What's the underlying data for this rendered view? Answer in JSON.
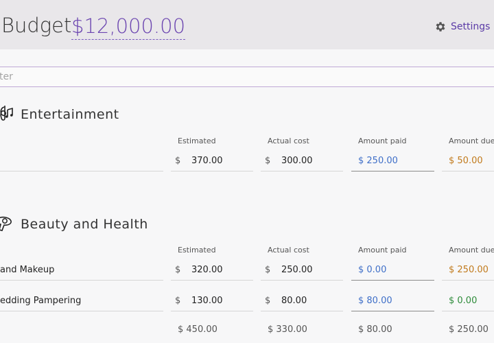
{
  "header": {
    "title": "Budget",
    "amount": "$12,000.00",
    "settings_label": "Settings"
  },
  "filter": {
    "placeholder": "ter"
  },
  "columns": {
    "estimated": "Estimated",
    "actual": "Actual cost",
    "paid": "Amount paid",
    "due": "Amount due"
  },
  "currency": "$",
  "sections": [
    {
      "title": "Entertainment",
      "icon": "music-notes-icon",
      "rows": [
        {
          "name": "",
          "estimated": "370.00",
          "actual": "300.00",
          "paid": "$ 250.00",
          "due": "$ 50.00"
        }
      ]
    },
    {
      "title": "Beauty and Health",
      "icon": "hair-dryer-icon",
      "rows": [
        {
          "name": "and Makeup",
          "estimated": "320.00",
          "actual": "250.00",
          "paid": "$ 0.00",
          "due": "$ 250.00"
        },
        {
          "name": "edding Pampering",
          "estimated": "130.00",
          "actual": "80.00",
          "paid": "$ 80.00",
          "due": "$ 0.00"
        }
      ],
      "totals": {
        "estimated": "$ 450.00",
        "actual": "$ 330.00",
        "paid": "$ 80.00",
        "due": "$ 250.00"
      }
    }
  ],
  "colors": {
    "accent": "#6b45b0",
    "paid": "#3f6fc8",
    "due_positive": "#c17a1c",
    "due_zero": "#2e8b3a"
  }
}
